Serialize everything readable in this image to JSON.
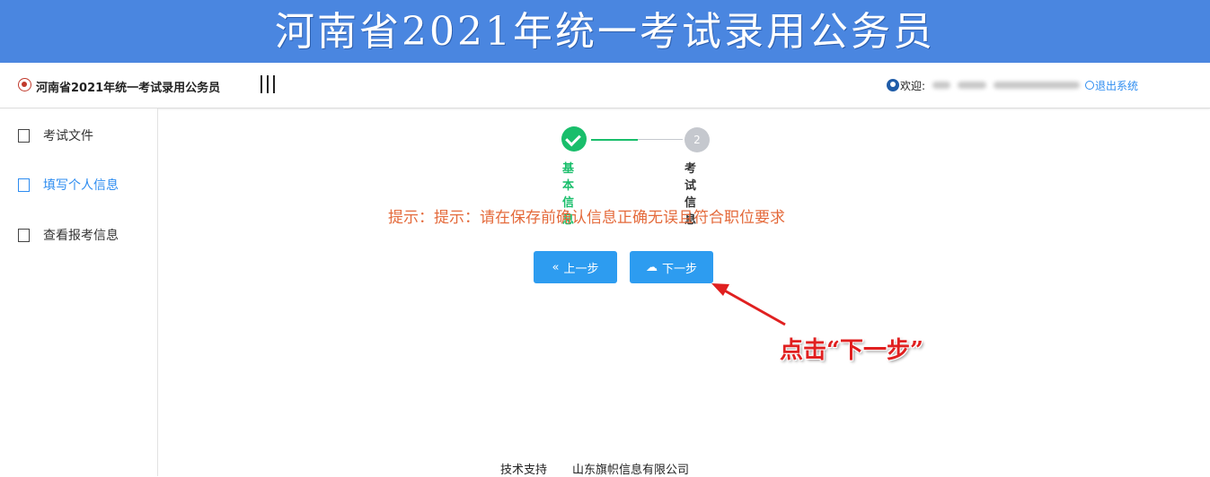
{
  "banner": {
    "title": "河南省2021年统一考试录用公务员"
  },
  "topbar": {
    "app_title": "河南省2021年统一考试录用公务员",
    "welcome": "欢迎:",
    "logout": "退出系统"
  },
  "sidebar": {
    "items": [
      {
        "label": "考试文件",
        "icon": "document-icon"
      },
      {
        "label": "填写个人信息",
        "icon": "form-icon",
        "active": true
      },
      {
        "label": "查看报考信息",
        "icon": "profile-search-icon"
      }
    ]
  },
  "steps": [
    {
      "label": "基本信息",
      "status": "done"
    },
    {
      "number": "2",
      "label": "考试信息",
      "status": "pending"
    }
  ],
  "hint": "提示：提示：请在保存前确认信息正确无误且符合职位要求",
  "buttons": {
    "prev": "上一步",
    "next": "下一步"
  },
  "annotation": "点击“下一步”",
  "footer": {
    "support_label": "技术支持",
    "company": "山东旗帜信息有限公司"
  },
  "colors": {
    "banner": "#4a86e0",
    "primary": "#2d9cf0",
    "success": "#19be6b",
    "hint": "#e46a3b",
    "annotation": "#e02020"
  }
}
